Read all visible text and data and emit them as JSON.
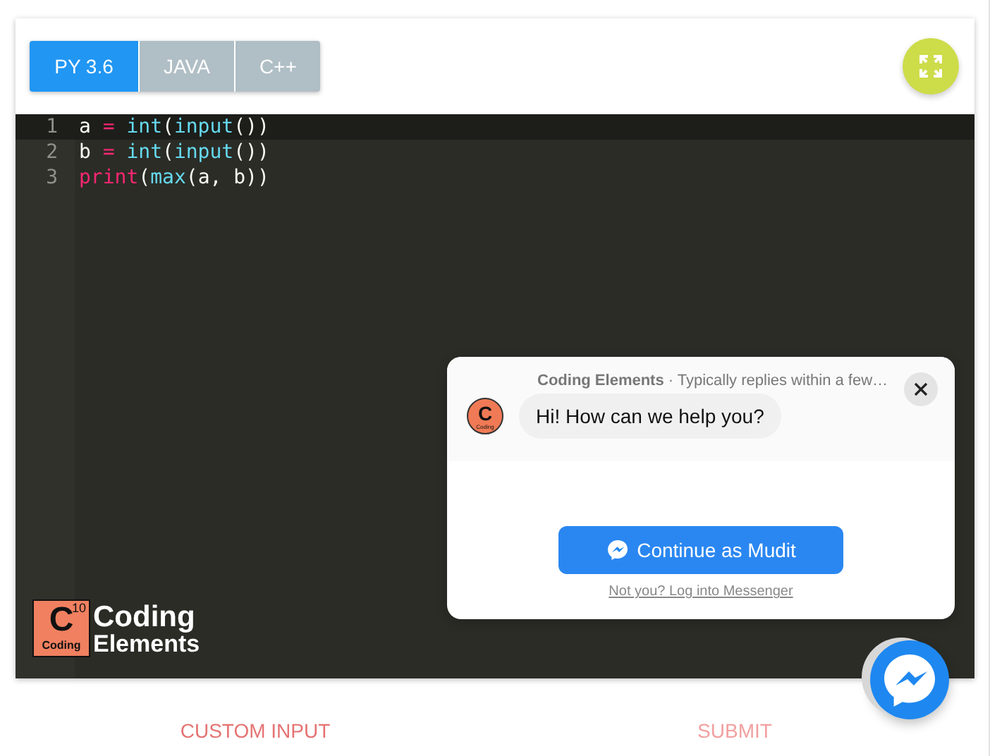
{
  "language_tabs": [
    {
      "label": "PY 3.6",
      "selected": true
    },
    {
      "label": "JAVA",
      "selected": false
    },
    {
      "label": "C++",
      "selected": false
    }
  ],
  "editor": {
    "lines": [
      {
        "number": "1",
        "active": true,
        "tokens": [
          {
            "kind": "plain",
            "text": "a "
          },
          {
            "kind": "operator",
            "text": "= "
          },
          {
            "kind": "builtin",
            "text": "int"
          },
          {
            "kind": "plain",
            "text": "("
          },
          {
            "kind": "builtin",
            "text": "input"
          },
          {
            "kind": "plain",
            "text": "())"
          }
        ]
      },
      {
        "number": "2",
        "active": false,
        "tokens": [
          {
            "kind": "plain",
            "text": "b "
          },
          {
            "kind": "operator",
            "text": "= "
          },
          {
            "kind": "builtin",
            "text": "int"
          },
          {
            "kind": "plain",
            "text": "("
          },
          {
            "kind": "builtin",
            "text": "input"
          },
          {
            "kind": "plain",
            "text": "())"
          }
        ]
      },
      {
        "number": "3",
        "active": false,
        "tokens": [
          {
            "kind": "keyword",
            "text": "print"
          },
          {
            "kind": "plain",
            "text": "("
          },
          {
            "kind": "builtin",
            "text": "max"
          },
          {
            "kind": "plain",
            "text": "(a, b))"
          }
        ]
      }
    ]
  },
  "logo": {
    "mark_letter": "C",
    "mark_number": "10",
    "mark_caption": "Coding",
    "name_lines": [
      "Coding",
      "Elements"
    ]
  },
  "chat_popup": {
    "page_name": "Coding Elements",
    "reply_time": "· Typically replies within a few…",
    "message": "Hi! How can we help you?",
    "avatar_letter": "C",
    "avatar_caption": "Coding",
    "continue_button": "Continue as Mudit",
    "login_link": "Not you? Log into Messenger"
  },
  "actions": [
    {
      "label": "CUSTOM INPUT",
      "disabled": false
    },
    {
      "label": "SUBMIT",
      "disabled": true
    }
  ]
}
